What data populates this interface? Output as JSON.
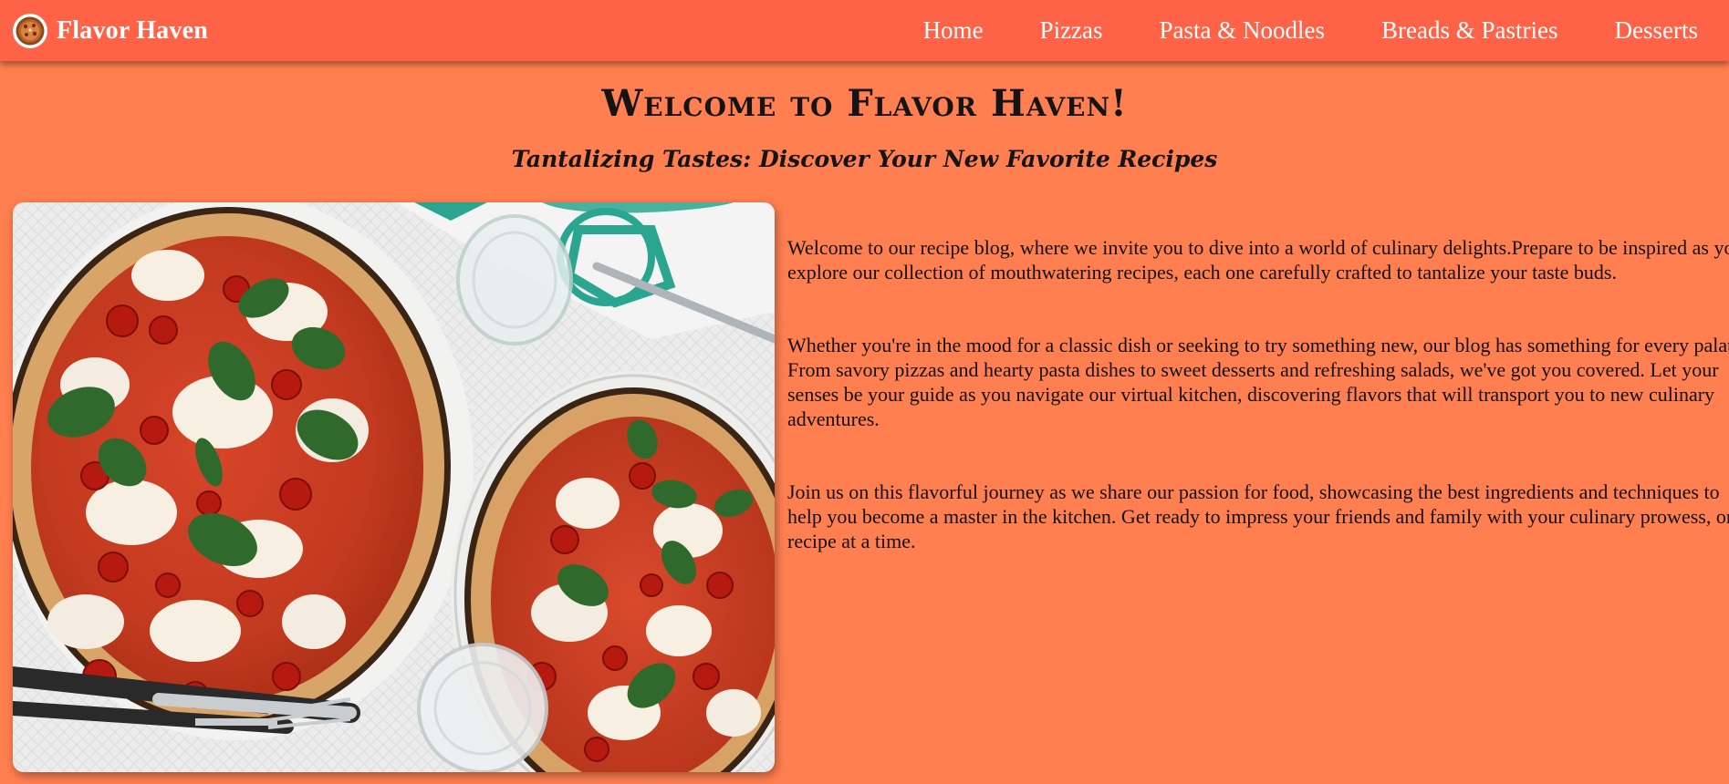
{
  "navbar": {
    "brand": "Flavor Haven",
    "logo_icon": "pizza-logo-icon",
    "links": [
      "Home",
      "Pizzas",
      "Pasta & Noodles",
      "Breads & Pastries",
      "Desserts"
    ]
  },
  "hero": {
    "title": "Welcome to Flavor Haven!",
    "subtitle": "Tantalizing Tastes: Discover Your New Favorite Recipes"
  },
  "intro": {
    "paragraphs": [
      "Welcome to our recipe blog, where we invite you to dive into a world of culinary delights.Prepare to be inspired as you explore our collection of mouthwatering recipes, each one carefully crafted to tantalize your taste buds.",
      "Whether you're in the mood for a classic dish or seeking to try something new, our blog has something for every palate. From savory pizzas and hearty pasta dishes to sweet desserts and refreshing salads, we've got you covered. Let your senses be your guide as you navigate our virtual kitchen, discovering flavors that will transport you to new culinary adventures.",
      "Join us on this flavorful journey as we share our passion for food, showcasing the best ingredients and techniques to help you become a master in the kitchen. Get ready to impress your friends and family with your culinary prowess, one recipe at a time."
    ]
  },
  "colors": {
    "navbar_bg": "#FF6347",
    "page_bg": "#FF7F50",
    "nav_text": "#FFFFFF",
    "heading_text": "#141414"
  }
}
